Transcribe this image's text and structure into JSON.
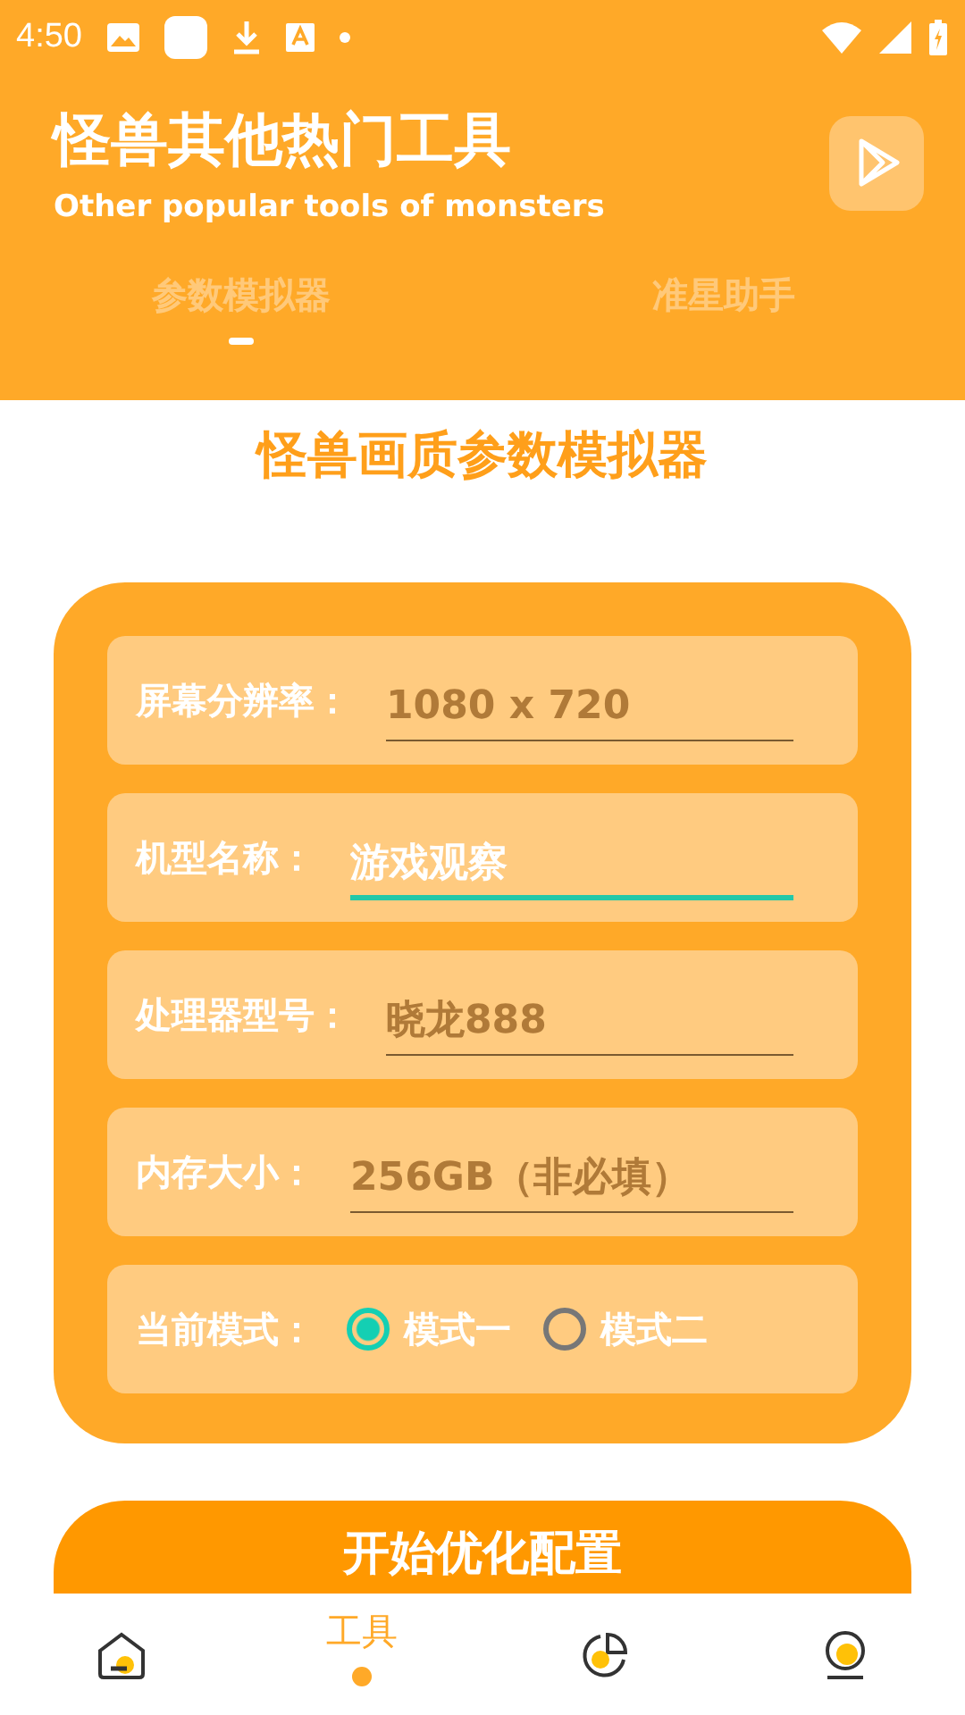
{
  "status_bar": {
    "time": "4:50"
  },
  "header": {
    "title": "怪兽其他热门工具",
    "subtitle": "Other popular tools of monsters"
  },
  "tabs": [
    {
      "label": "参数模拟器",
      "selected": true
    },
    {
      "label": "准星助手",
      "selected": false
    }
  ],
  "heading": "怪兽画质参数模拟器",
  "form": [
    {
      "kind": "field",
      "label": "屏幕分辨率：",
      "placeholder": "1080 x 720",
      "focused": false
    },
    {
      "kind": "field",
      "label": "机型名称：",
      "value": "游戏观察",
      "focused": true
    },
    {
      "kind": "field",
      "label": "处理器型号：",
      "placeholder": "晓龙888",
      "focused": false
    },
    {
      "kind": "field",
      "label": "内存大小：",
      "placeholder": "256GB（非必填）",
      "focused": false
    },
    {
      "kind": "radio",
      "label": "当前模式：",
      "options": [
        {
          "label": "模式一",
          "selected": true
        },
        {
          "label": "模式二",
          "selected": false
        }
      ]
    }
  ],
  "start_button": "开始优化配置",
  "bottom_nav": [
    {
      "kind": "home",
      "selected": false
    },
    {
      "kind": "tools",
      "label": "工具",
      "selected": true
    },
    {
      "kind": "stats",
      "selected": false
    },
    {
      "kind": "profile",
      "selected": false
    }
  ]
}
